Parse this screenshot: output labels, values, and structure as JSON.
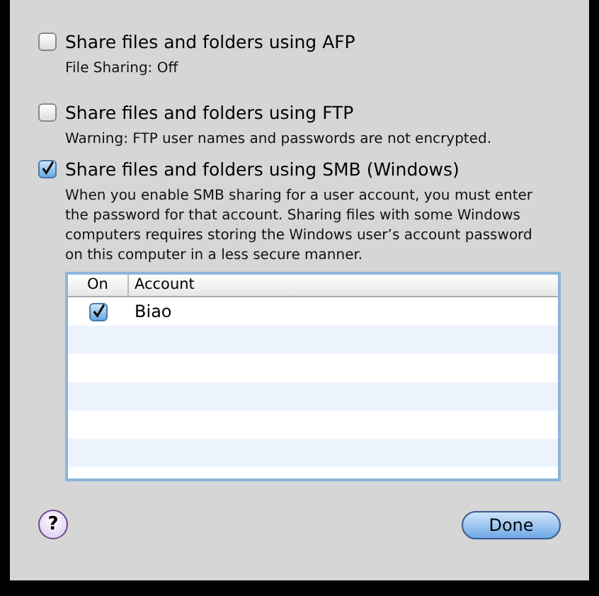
{
  "options": [
    {
      "label": "Share files and folders using AFP",
      "checked": false,
      "note": "File Sharing: Off"
    },
    {
      "label": "Share files and folders using FTP",
      "checked": false,
      "note": "Warning: FTP user names and passwords are not encrypted."
    },
    {
      "label": "Share files and folders using SMB (Windows)",
      "checked": true,
      "note": "When you enable SMB sharing for a user account, you must enter the password for that account. Sharing files with some Windows computers requires storing the Windows user’s account password on this computer in a less secure manner."
    }
  ],
  "table": {
    "columns": [
      "On",
      "Account"
    ],
    "rows": [
      {
        "on": true,
        "account": "Biao"
      }
    ]
  },
  "help_button": "?",
  "buttons": [
    {
      "label": "Done",
      "default": true
    }
  ]
}
